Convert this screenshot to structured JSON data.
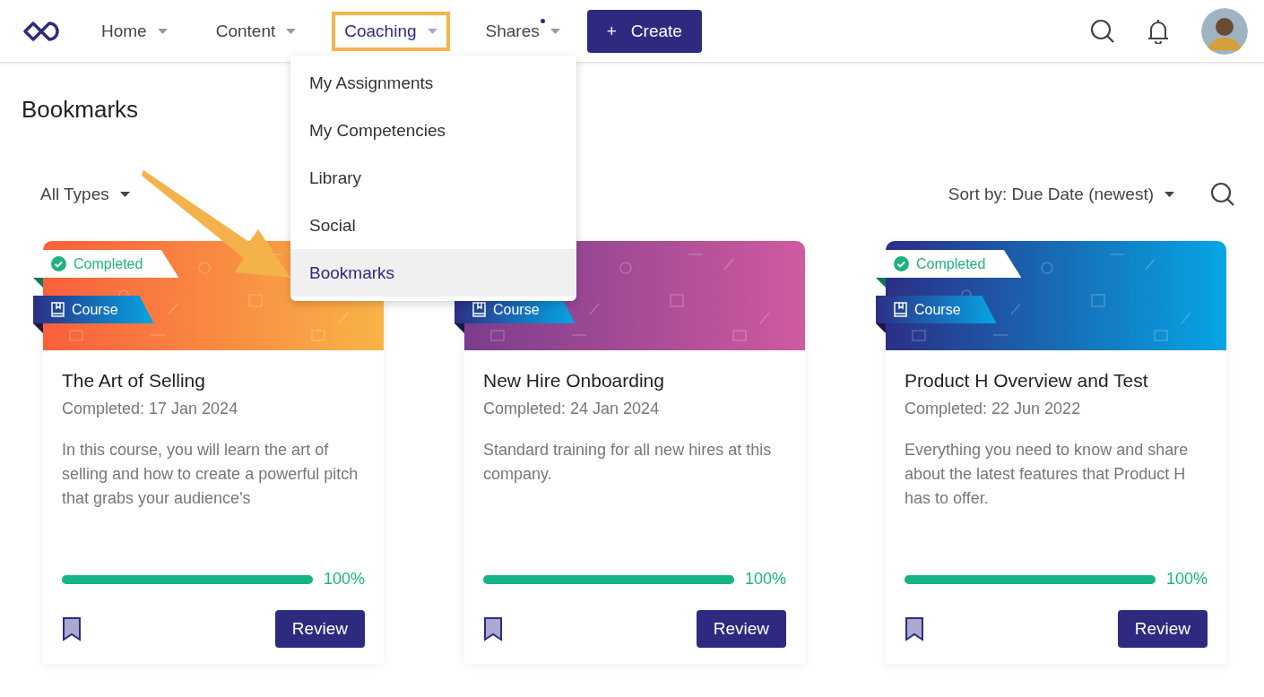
{
  "nav": {
    "items": [
      {
        "label": "Home",
        "selected": false,
        "highlighted": false,
        "notification": false
      },
      {
        "label": "Content",
        "selected": false,
        "highlighted": false,
        "notification": false
      },
      {
        "label": "Coaching",
        "selected": true,
        "highlighted": true,
        "notification": false
      },
      {
        "label": "Shares",
        "selected": false,
        "highlighted": false,
        "notification": true
      }
    ],
    "create_icon": "+",
    "create_button": "Create"
  },
  "dropdown": {
    "items": [
      {
        "label": "My Assignments",
        "selected": false
      },
      {
        "label": "My Competencies",
        "selected": false
      },
      {
        "label": "Library",
        "selected": false
      },
      {
        "label": "Social",
        "selected": false
      },
      {
        "label": "Bookmarks",
        "selected": true
      }
    ],
    "annotation_arrow": true
  },
  "page": {
    "title": "Bookmarks",
    "filter": "All Types",
    "sort": "Sort by: Due Date (newest)"
  },
  "cards": [
    {
      "kind": "orange",
      "badge": "Completed",
      "type": "Course",
      "title": "The Art of Selling",
      "date": "Completed: 17 Jan 2024",
      "description": "In this course, you will learn the art of selling and how to create a powerful pitch that grabs your audience's",
      "level": 1,
      "progress": "100%",
      "bookmarked": true,
      "button": "Review"
    },
    {
      "kind": "purple",
      "type": "Course",
      "title": "New Hire Onboarding",
      "date": "Completed: 24 Jan 2024",
      "description": "Standard training for all new hires at this company.",
      "level": 1,
      "progress": "100%",
      "bookmarked": true,
      "button": "Review"
    },
    {
      "kind": "blue",
      "badge": "Completed",
      "type": "Course",
      "title": "Product H Overview and Test",
      "date": "Completed: 22 Jun 2022",
      "description": "Everything you need to know and share about the latest features that Product H has to offer.",
      "level": 1,
      "progress": "100%",
      "bookmarked": true,
      "button": "Review"
    }
  ]
}
